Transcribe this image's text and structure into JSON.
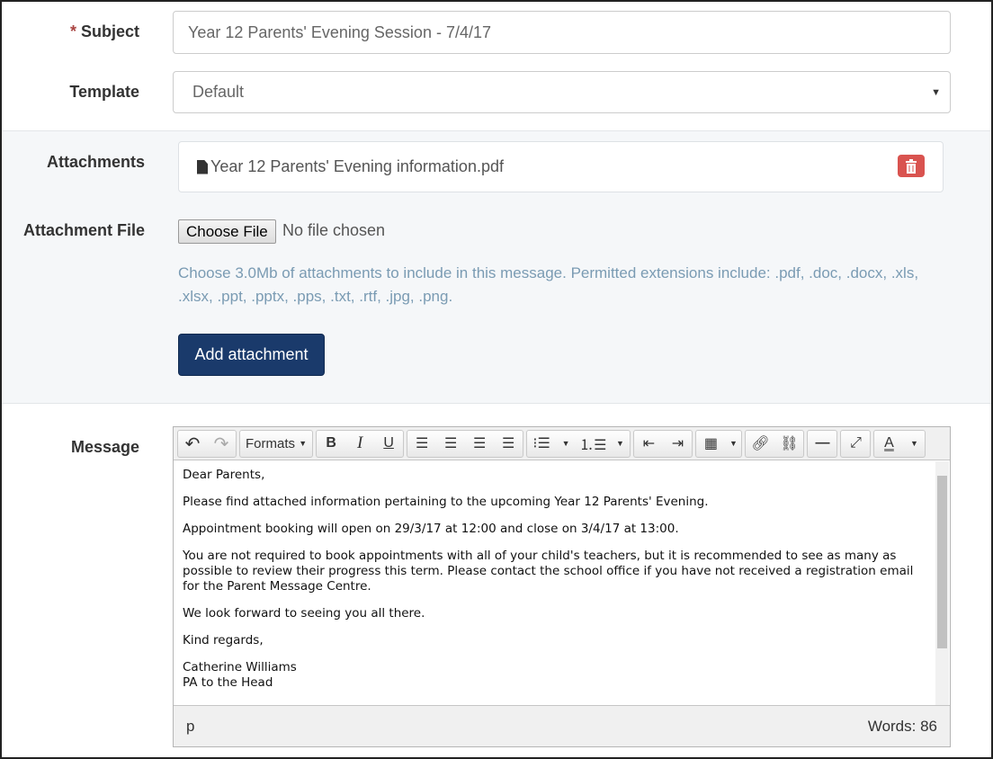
{
  "subject": {
    "required_mark": "*",
    "label": "Subject",
    "value": "Year 12 Parents' Evening Session - 7/4/17"
  },
  "template": {
    "label": "Template",
    "value": "Default"
  },
  "attachments": {
    "label": "Attachments",
    "items": [
      {
        "name": "Year 12 Parents' Evening information.pdf"
      }
    ]
  },
  "attachment_file": {
    "label": "Attachment File",
    "choose_label": "Choose File",
    "status": "No file chosen",
    "help": "Choose 3.0Mb of attachments to include in this message. Permitted extensions include: .pdf, .doc, .docx, .xls, .xlsx, .ppt, .pptx, .pps, .txt, .rtf, .jpg, .png.",
    "add_label": "Add attachment"
  },
  "message": {
    "label": "Message",
    "toolbar": {
      "formats_label": "Formats"
    },
    "paragraphs": [
      "Dear Parents,",
      "Please find attached information pertaining to the upcoming Year 12 Parents' Evening.",
      "Appointment booking will open on 29/3/17 at 12:00 and close on 3/4/17 at 13:00.",
      "You are not required to book appointments with all of your child's teachers, but it is recommended to see as many as possible to review their progress this term.  Please contact the school office if you have not received a registration email for the Parent Message Centre.",
      "We look forward to seeing you all there.",
      "Kind regards,"
    ],
    "signature_name": "Catherine Williams",
    "signature_title": "PA to the Head",
    "path": "p",
    "word_count": "Words: 86"
  },
  "colors": {
    "primary": "#1a3a6b",
    "danger": "#d9534f",
    "help_text": "#7a9bb3"
  }
}
